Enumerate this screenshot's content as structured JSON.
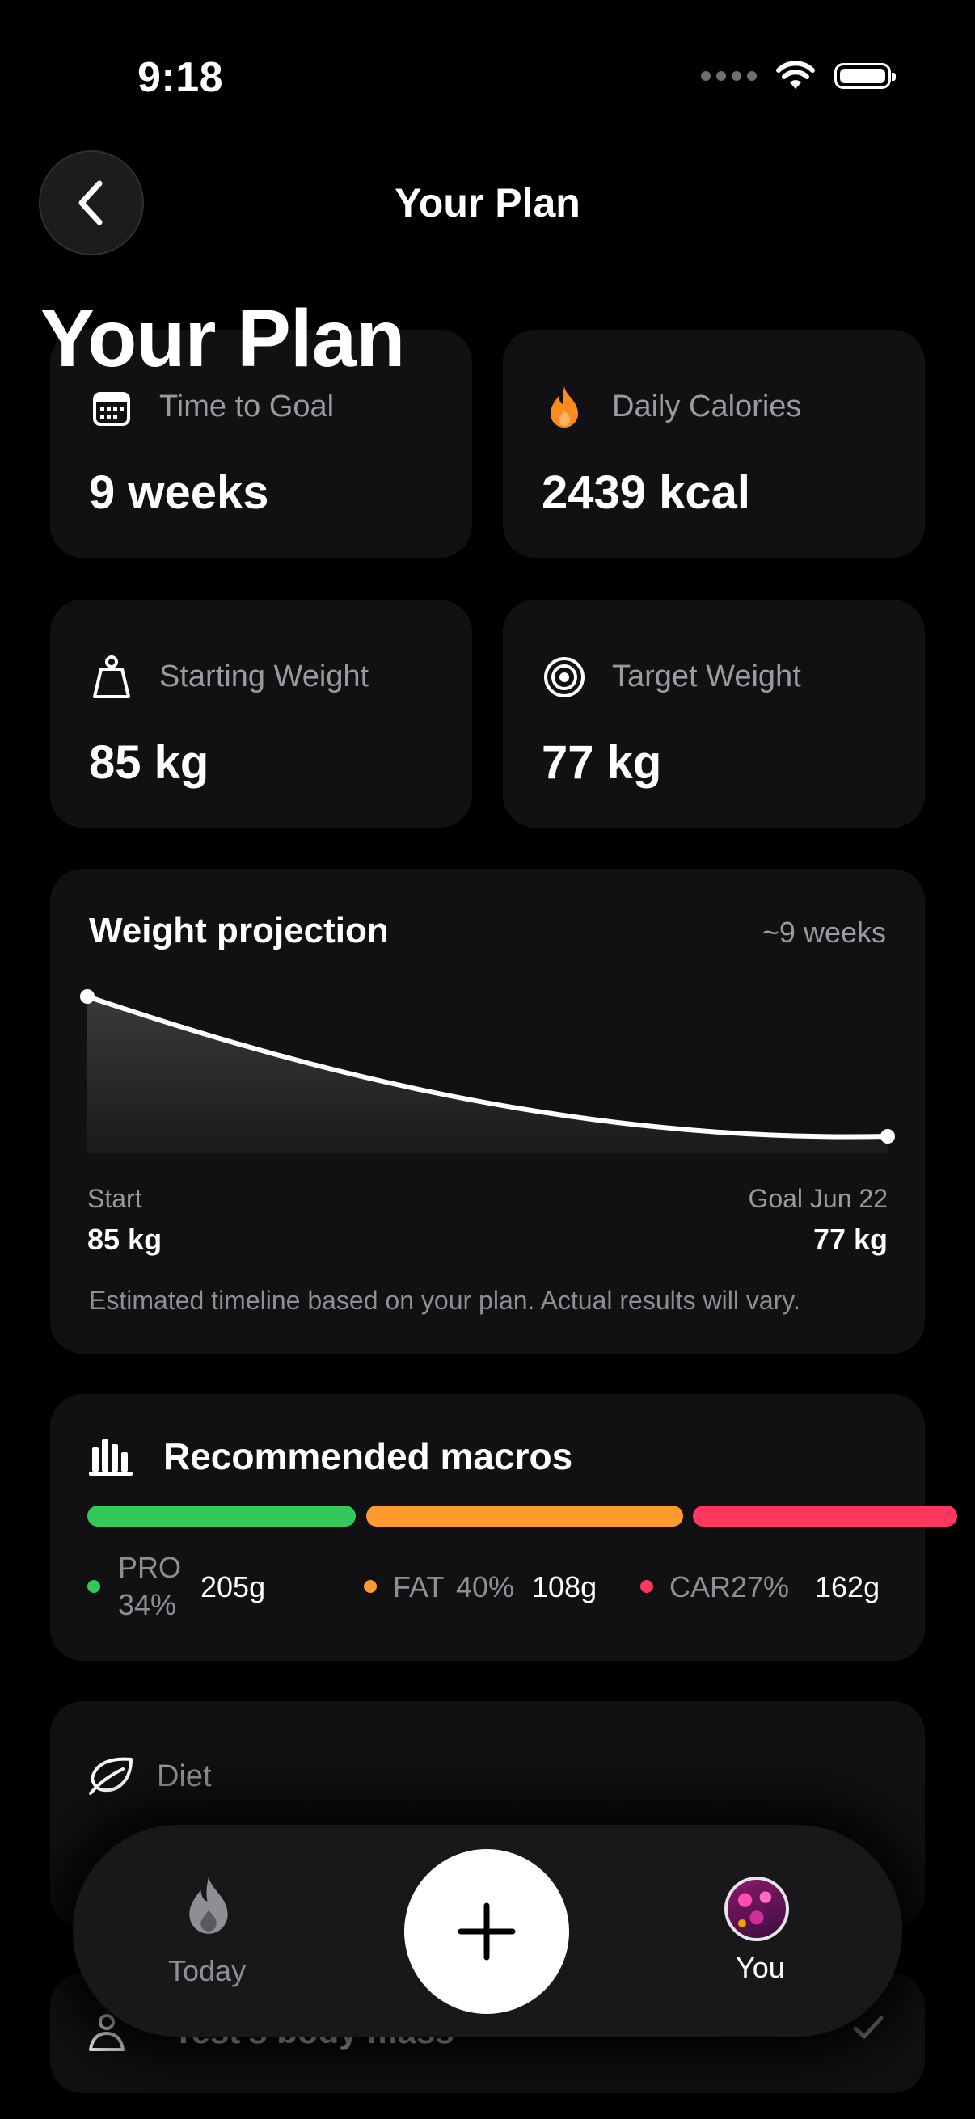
{
  "status_bar": {
    "time": "9:18"
  },
  "nav": {
    "title": "Your Plan",
    "back_icon": "chevron-left-icon"
  },
  "header": {
    "large_title": "Your Plan"
  },
  "stats": [
    {
      "label": "Time to Goal",
      "value": "9 weeks",
      "icon": "calendar-icon"
    },
    {
      "label": "Daily Calories",
      "value": "2439 kcal",
      "icon": "flame-icon",
      "icon_color": "#ff8a1f"
    },
    {
      "label": "Starting Weight",
      "value": "85 kg",
      "icon": "weight-icon"
    },
    {
      "label": "Target Weight",
      "value": "77 kg",
      "icon": "target-icon"
    }
  ],
  "projection": {
    "title": "Weight projection",
    "duration": "~9 weeks",
    "start_label": "Start",
    "start_value": "85 kg",
    "goal_label": "Goal Jun 22",
    "goal_value": "77 kg",
    "note": "Estimated timeline based on your plan. Actual results will vary."
  },
  "macros": {
    "title": "Recommended macros",
    "icon": "bar-chart-icon",
    "items": [
      {
        "name": "PRO",
        "percent": "34%",
        "grams": "205g",
        "color": "#34c759"
      },
      {
        "name": "FAT",
        "percent": "40%",
        "grams": "108g",
        "color": "#ff9a2e"
      },
      {
        "name": "CAR",
        "percent": "27%",
        "grams": "162g",
        "color": "#ff375f"
      }
    ]
  },
  "diet": {
    "label": "Diet",
    "icon": "leaf-icon"
  },
  "body_mass": {
    "label": "Test's body mass",
    "icon": "person-icon",
    "check_icon": "checkmark-icon"
  },
  "tabbar": {
    "today_label": "Today",
    "add_icon": "plus-icon",
    "you_label": "You"
  }
}
